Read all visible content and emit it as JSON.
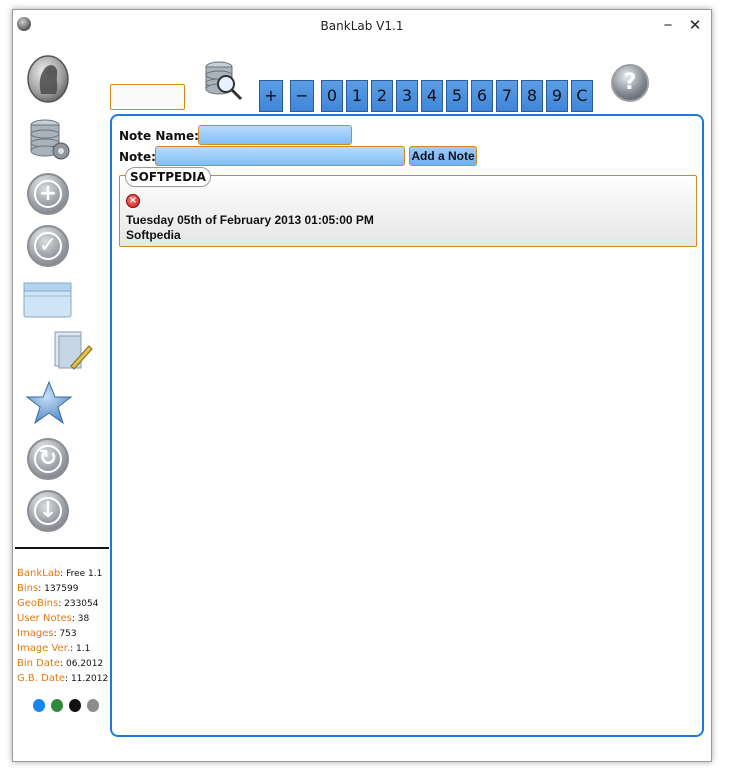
{
  "window": {
    "title": "BankLab  V1.1",
    "minimize_glyph": "−",
    "close_glyph": "✕"
  },
  "sidebar": {
    "icons": [
      "logo-portrait-icon",
      "database-settings-icon",
      "add-icon",
      "check-icon",
      "window-icon",
      "folder-edit-icon",
      "star-icon",
      "refresh-icon",
      "download-icon"
    ],
    "add_glyph": "+",
    "check_glyph": "✓",
    "refresh_glyph": "↻",
    "download_glyph": "↓"
  },
  "stats": [
    {
      "label": "BankLab",
      "value": "Free 1.1"
    },
    {
      "label": "Bins",
      "value": "137599"
    },
    {
      "label": "GeoBins",
      "value": "233054"
    },
    {
      "label": "User Notes",
      "value": "38"
    },
    {
      "label": "Images",
      "value": "753"
    },
    {
      "label": "Image Ver.",
      "value": "1.1"
    },
    {
      "label": "Bin Date",
      "value": "06.2012"
    },
    {
      "label": "G.B. Date",
      "value": "11.2012"
    }
  ],
  "theme_colors": [
    "#1a84f0",
    "#2f8a3c",
    "#111111",
    "#8c8c8c"
  ],
  "toolbar": {
    "search_value": "",
    "keypad": [
      "+",
      "−",
      "0",
      "1",
      "2",
      "3",
      "4",
      "5",
      "6",
      "7",
      "8",
      "9",
      "C"
    ],
    "help_glyph": "?"
  },
  "notes_form": {
    "note_name_label": "Note Name:",
    "note_name_value": "",
    "note_label": "Note:",
    "note_value": "",
    "add_button": "Add a Note"
  },
  "notes": [
    {
      "title": "SOFTPEDIA",
      "date": "Tuesday 05th of February 2013 01:05:00 PM",
      "text": "Softpedia"
    }
  ],
  "accent_orange": "#d18a1a",
  "accent_blue": "#1e7ad6"
}
